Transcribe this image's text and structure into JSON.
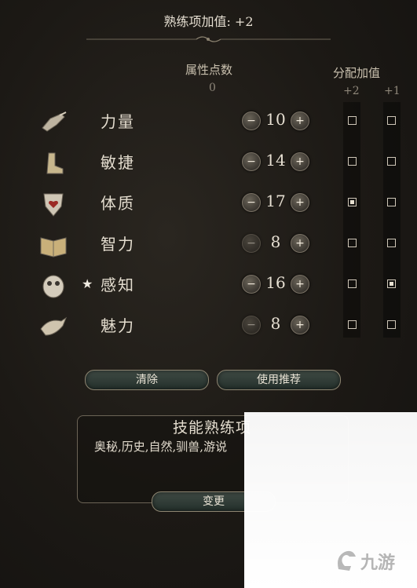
{
  "header": {
    "proficiency_bonus": "熟练项加值: +2"
  },
  "columns": {
    "points_title": "属性点数",
    "points_remaining": "0",
    "alloc_title": "分配加值",
    "alloc_plus2": "+2",
    "alloc_plus1": "+1"
  },
  "attributes": [
    {
      "label": "力量",
      "value": "10",
      "star": "",
      "icon": "gauntlet-icon",
      "minus_active": true,
      "plus2_checked": false,
      "plus1_checked": false
    },
    {
      "label": "敏捷",
      "value": "14",
      "star": "",
      "icon": "boot-icon",
      "minus_active": true,
      "plus2_checked": false,
      "plus1_checked": false
    },
    {
      "label": "体质",
      "value": "17",
      "star": "",
      "icon": "heart-shield-icon",
      "minus_active": true,
      "plus2_checked": true,
      "plus1_checked": false
    },
    {
      "label": "智力",
      "value": "8",
      "star": "",
      "icon": "open-book-icon",
      "minus_active": false,
      "plus2_checked": false,
      "plus1_checked": false
    },
    {
      "label": "感知",
      "value": "16",
      "star": "★",
      "icon": "owl-icon",
      "minus_active": true,
      "plus2_checked": false,
      "plus1_checked": true
    },
    {
      "label": "魅力",
      "value": "8",
      "star": "",
      "icon": "bird-feather-icon",
      "minus_active": false,
      "plus2_checked": false,
      "plus1_checked": false
    }
  ],
  "buttons": {
    "clear": "清除",
    "use_recommended": "使用推荐",
    "change": "变更",
    "minus_glyph": "−",
    "plus_glyph": "+"
  },
  "skills_panel": {
    "title": "技能熟练项",
    "list": "奥秘,历史,自然,驯兽,游说"
  },
  "colors": {
    "accent_gold": "#8d8571",
    "button_teal": "#2d3a34",
    "text_light": "#e4ddcf"
  }
}
